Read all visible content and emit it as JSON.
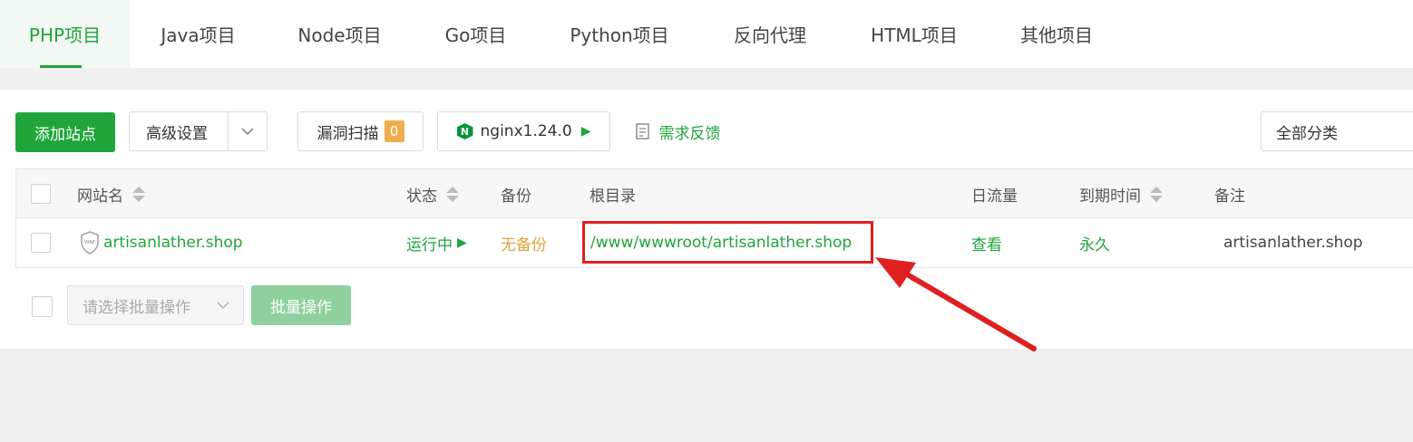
{
  "tabs": [
    {
      "label": "PHP项目",
      "active": true
    },
    {
      "label": "Java项目"
    },
    {
      "label": "Node项目"
    },
    {
      "label": "Go项目"
    },
    {
      "label": "Python项目"
    },
    {
      "label": "反向代理"
    },
    {
      "label": "HTML项目"
    },
    {
      "label": "其他项目"
    }
  ],
  "toolbar": {
    "add_site": "添加站点",
    "advanced": "高级设置",
    "vuln_scan": "漏洞扫描",
    "vuln_count": "0",
    "nginx": "nginx1.24.0",
    "feedback": "需求反馈",
    "category": "全部分类"
  },
  "table": {
    "headers": {
      "name": "网站名",
      "status": "状态",
      "backup": "备份",
      "root": "根目录",
      "traffic": "日流量",
      "expire": "到期时间",
      "note": "备注"
    },
    "rows": [
      {
        "waf": "WAF",
        "name": "artisanlather.shop",
        "status": "运行中",
        "backup": "无备份",
        "root": "/www/wwwroot/artisanlather.shop",
        "traffic": "查看",
        "expire": "永久",
        "note": "artisanlather.shop"
      }
    ]
  },
  "batch": {
    "placeholder": "请选择批量操作",
    "button": "批量操作"
  },
  "colors": {
    "accent": "#20a53a",
    "warning": "#e6a23c",
    "annotation": "#e02020"
  }
}
